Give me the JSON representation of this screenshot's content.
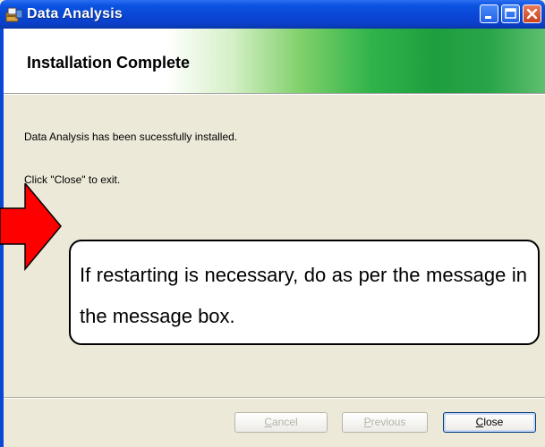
{
  "window": {
    "title": "Data Analysis",
    "controls": [
      "minimize-icon",
      "maximize-icon",
      "close-icon"
    ]
  },
  "banner": {
    "title": "Installation Complete"
  },
  "content": {
    "message": "Data Analysis has been sucessfully installed.",
    "instruction": "Click \"Close\" to exit."
  },
  "callout": {
    "text": "If restarting is necessary, do as per the message in the message box.",
    "arrow_color": "#ff0000"
  },
  "buttons": {
    "cancel_accel": "C",
    "cancel_rest": "ancel",
    "previous_accel": "P",
    "previous_rest": "revious",
    "close_accel": "C",
    "close_rest": "lose"
  },
  "colors": {
    "titlebar": "#0a46d6",
    "dialog_bg": "#ECE9D8",
    "banner_green": "#1e9e3e"
  }
}
